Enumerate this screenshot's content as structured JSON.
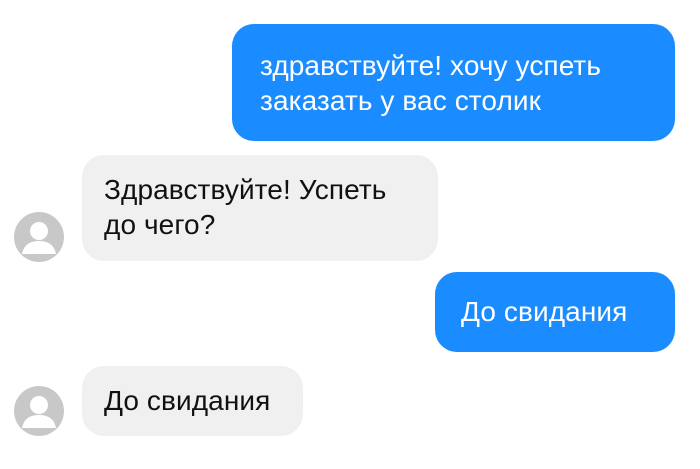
{
  "conversation": {
    "messages": [
      {
        "sender": "me",
        "text": "здравствуйте! хочу успеть заказать у вас столик"
      },
      {
        "sender": "them",
        "text": "Здравствуйте! Успеть до чего?"
      },
      {
        "sender": "me",
        "text": "До свидания"
      },
      {
        "sender": "them",
        "text": "До свидания"
      }
    ]
  },
  "colors": {
    "outgoing_bubble": "#1a8cff",
    "incoming_bubble": "#f0f0f0",
    "avatar_bg": "#c8c8c8",
    "avatar_fg": "#ffffff"
  },
  "icons": {
    "avatar": "default-user-icon"
  }
}
